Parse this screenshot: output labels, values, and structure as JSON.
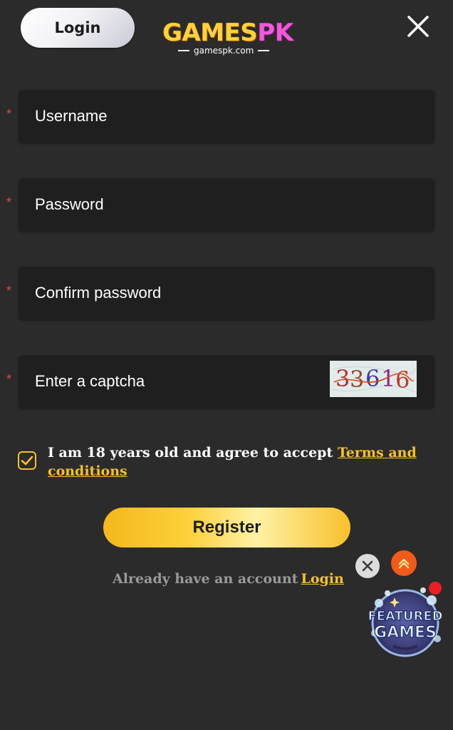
{
  "header": {
    "login_label": "Login",
    "logo": {
      "brand_part1": "GAMES",
      "brand_part2": "PK",
      "domain": "gamespk.com"
    },
    "close_icon": "close-icon"
  },
  "form": {
    "required_marker": "*",
    "username": {
      "placeholder": "Username",
      "value": ""
    },
    "password": {
      "placeholder": "Password",
      "value": ""
    },
    "confirm_password": {
      "placeholder": "Confirm password",
      "value": ""
    },
    "captcha": {
      "placeholder": "Enter a captcha",
      "value": "",
      "image_text": "33616"
    }
  },
  "agreement": {
    "checked": true,
    "text": "I am 18 years old and agree to accept ",
    "link_label": "Terms and conditions"
  },
  "register_label": "Register",
  "already": {
    "text": "Already have an account",
    "link_label": "Login"
  },
  "floating": {
    "close_icon": "close-circle-icon",
    "scroll_top_icon": "double-chevron-up-icon",
    "featured_line1": "FEATURED",
    "featured_line2": "GAMES",
    "notification": true
  },
  "colors": {
    "background": "#2b2b2b",
    "field": "#1f1f1f",
    "accent_gold": "#f5c22a",
    "required_red": "#e04848",
    "scroll_top_orange": "#f25a1c"
  }
}
